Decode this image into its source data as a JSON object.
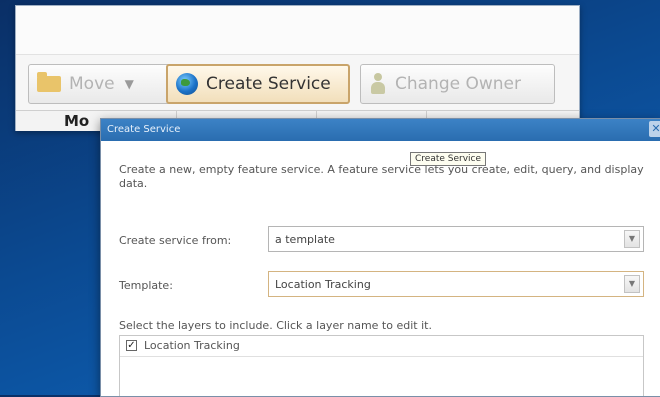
{
  "toolbar": {
    "move_label": "Move",
    "create_service_label": "Create Service",
    "change_owner_label": "Change Owner",
    "column_header": "Mo",
    "icons": {
      "move": "folder-icon",
      "create": "globe-icon",
      "owner": "person-icon",
      "dropdown": "chevron-down-icon"
    }
  },
  "tooltip": {
    "text": "Create Service"
  },
  "dialog": {
    "title": "Create Service",
    "description": "Create a new, empty feature service. A feature service lets you create, edit, query, and display data.",
    "create_from_label": "Create service from:",
    "create_from_value": "a template",
    "template_label": "Template:",
    "template_value": "Location Tracking",
    "layers_label": "Select the layers to include. Click a layer name to edit it.",
    "layers": [
      {
        "name": "Location Tracking",
        "checked": true
      }
    ]
  },
  "colors": {
    "background": "#0b4a92",
    "title_bar": "#2a6db0",
    "highlight_border": "#c9a46a"
  }
}
